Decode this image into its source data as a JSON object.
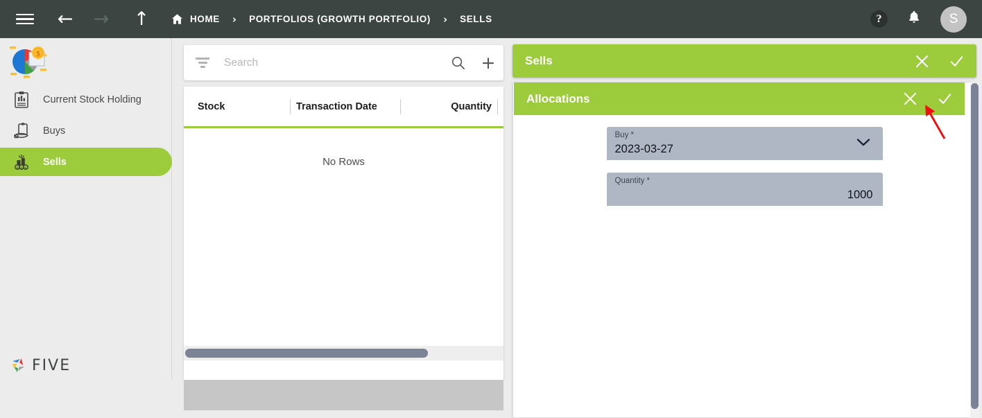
{
  "topbar": {
    "menu_icon": "hamburger-icon",
    "back_icon": "arrow-left-icon",
    "forward_icon": "arrow-right-icon",
    "up_icon": "arrow-up-icon",
    "home_icon": "home-icon",
    "breadcrumbs": [
      {
        "label": "HOME"
      },
      {
        "label": "PORTFOLIOS (GROWTH PORTFOLIO)"
      },
      {
        "label": "SELLS"
      }
    ],
    "separator": "›",
    "help_icon": "question-mark-icon",
    "help_glyph": "?",
    "notifications_icon": "bell-icon",
    "avatar_initial": "S",
    "background_color": "#3d4543"
  },
  "sidebar": {
    "logo_icon": "portfolio-pie-chart-logo",
    "items": [
      {
        "label": "Current Stock Holding",
        "icon": "clipboard-chart-icon",
        "active": false
      },
      {
        "label": "Buys",
        "icon": "hand-clipboard-icon",
        "active": false
      },
      {
        "label": "Sells",
        "icon": "money-stack-icon",
        "active": true
      }
    ],
    "footer_brand": "FIVE",
    "footer_icon": "five-pinwheel-logo",
    "active_color": "#9ccb3b"
  },
  "list_panel": {
    "search": {
      "placeholder": "Search",
      "value": "",
      "filter_icon": "filter-icon",
      "search_icon": "search-icon",
      "add_icon": "plus-icon"
    },
    "grid": {
      "columns": [
        {
          "label": "Stock",
          "align": "left"
        },
        {
          "label": "Transaction Date",
          "align": "left"
        },
        {
          "label": "Quantity",
          "align": "right"
        }
      ],
      "rows": [],
      "empty_message": "No Rows",
      "accent_color": "#9ccb3b"
    }
  },
  "detail_panel": {
    "sells_card": {
      "title": "Sells",
      "close_icon": "close-icon",
      "confirm_icon": "check-icon"
    },
    "allocations_card": {
      "title": "Allocations",
      "close_icon": "close-icon",
      "confirm_icon": "check-icon"
    },
    "form": {
      "fields": [
        {
          "label": "Buy *",
          "value": "2023-03-27",
          "type": "dropdown",
          "align": "left",
          "icon": "chevron-down-icon"
        },
        {
          "label": "Quantity *",
          "value": "1000",
          "type": "number",
          "align": "right",
          "icon": ""
        }
      ]
    },
    "header_color": "#9ccb3b"
  },
  "annotation": {
    "arrow_icon": "red-pointer-arrow",
    "color": "#ee1111"
  }
}
